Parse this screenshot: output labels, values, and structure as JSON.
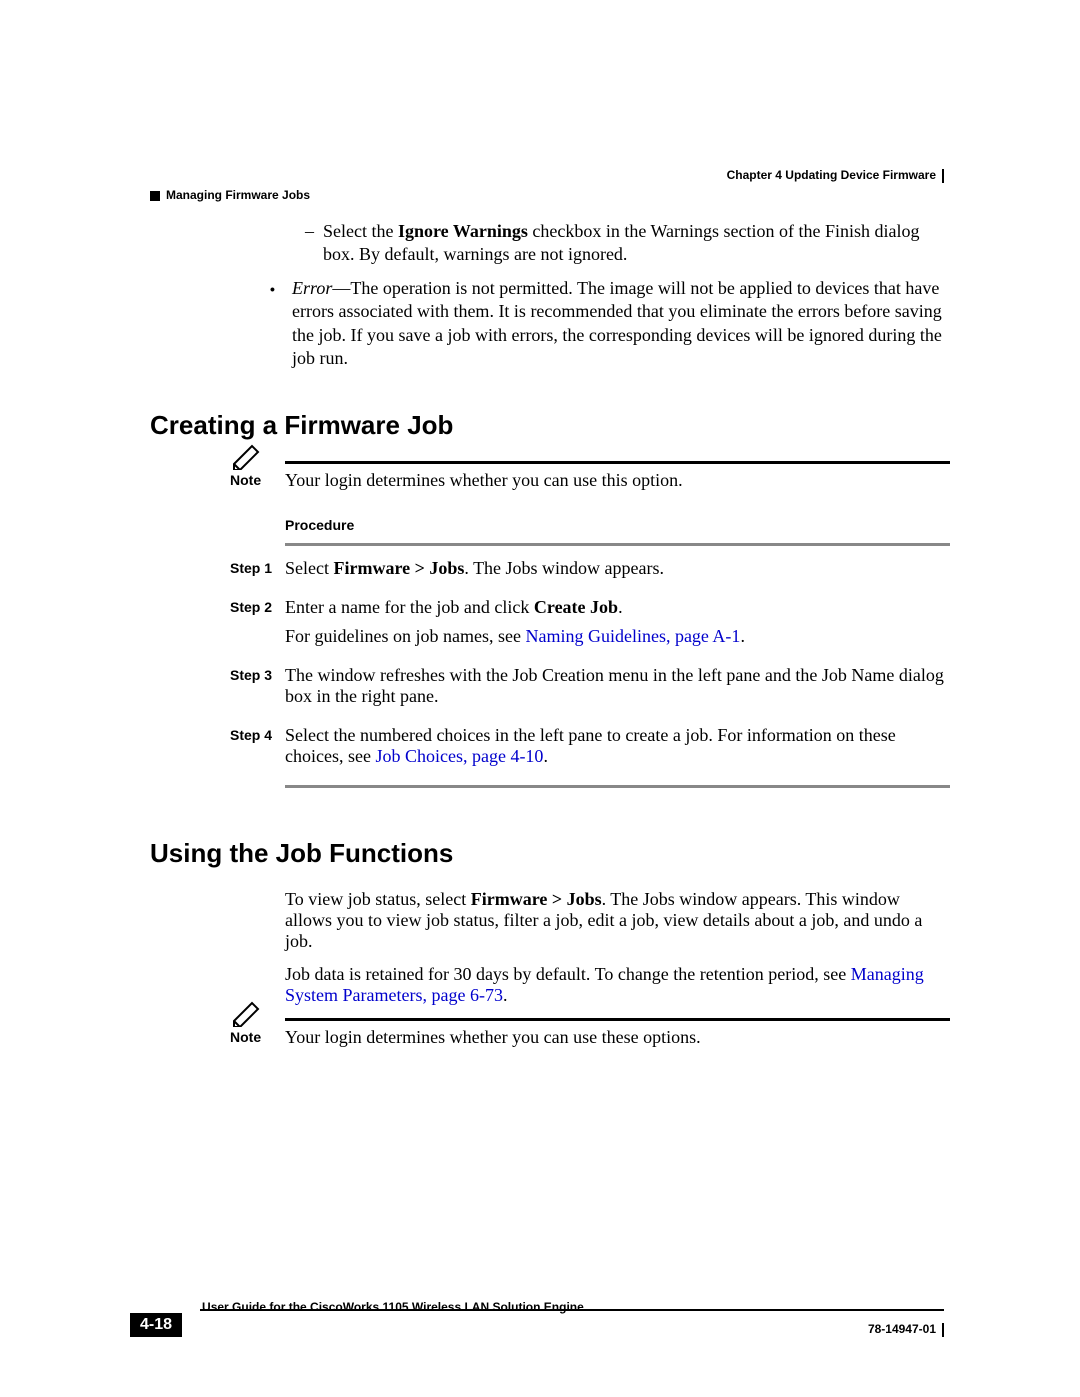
{
  "header": {
    "chapter": "Chapter 4    Updating Device Firmware",
    "section": "Managing Firmware Jobs"
  },
  "body": {
    "dash_item_prefix": "Select the ",
    "dash_item_bold": "Ignore Warnings",
    "dash_item_rest": " checkbox in the Warnings section of the Finish dialog box. By default, warnings are not ignored.",
    "error_label": "Error",
    "error_text": "—The operation is not permitted. The image will not be applied to devices that have errors associated with them. It is recommended that you eliminate the errors before saving the job. If you save a job with errors, the corresponding devices will be ignored during the job run."
  },
  "section1": {
    "title": "Creating a Firmware Job",
    "note_label": "Note",
    "note_text": "Your login determines whether you can use this option.",
    "procedure_label": "Procedure",
    "steps": {
      "s1_label": "Step 1",
      "s1_a": "Select ",
      "s1_bold": "Firmware > Jobs",
      "s1_b": ". The Jobs window appears.",
      "s2_label": "Step 2",
      "s2_a": "Enter a name for the job and click ",
      "s2_bold": "Create Job",
      "s2_b": ".",
      "s2_c": "For guidelines on job names, see ",
      "s2_link": "Naming Guidelines, page A-1",
      "s2_d": ".",
      "s3_label": "Step 3",
      "s3_text": "The window refreshes with the Job Creation menu in the left pane and the Job Name dialog box in the right pane.",
      "s4_label": "Step 4",
      "s4_a": "Select the numbered choices in the left pane to create a job. For information on these choices, see ",
      "s4_link": "Job Choices, page 4-10",
      "s4_b": "."
    }
  },
  "section2": {
    "title": "Using the Job Functions",
    "p1_a": "To view job status, select ",
    "p1_bold": "Firmware > Jobs",
    "p1_b": ". The Jobs window appears. This window allows you to view job status, filter a job, edit a job, view details about a job, and undo a job.",
    "p2_a": "Job data is retained for 30 days by default. To change the retention period, see ",
    "p2_link": "Managing System Parameters, page 6-73",
    "p2_b": ".",
    "note_label": "Note",
    "note_text": "Your login determines whether you can use these options."
  },
  "footer": {
    "page": "4-18",
    "title": "User Guide for the CiscoWorks 1105 Wireless LAN Solution Engine",
    "docnum": "78-14947-01"
  }
}
